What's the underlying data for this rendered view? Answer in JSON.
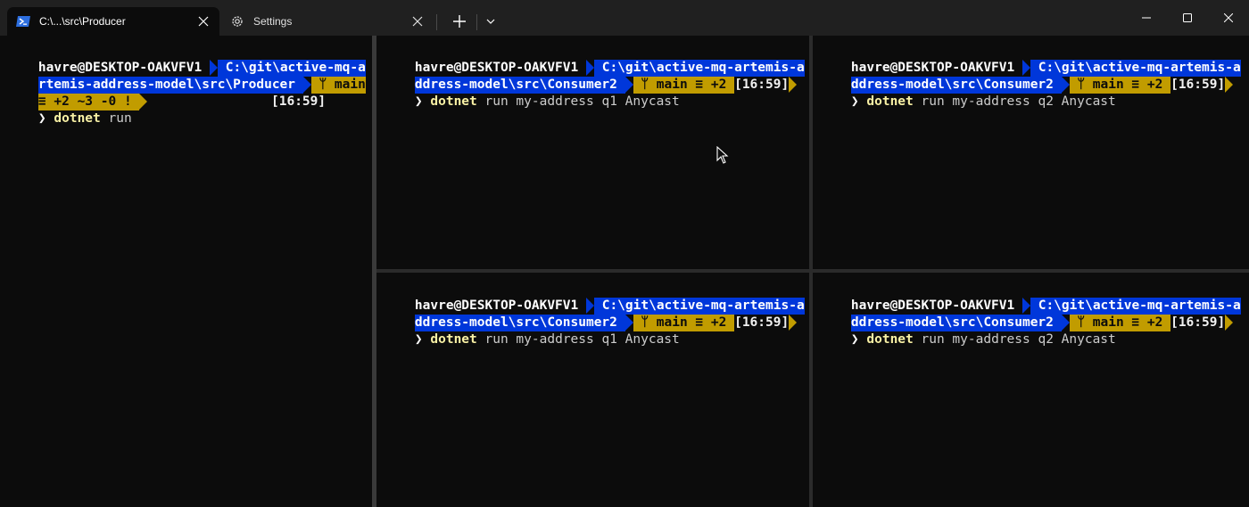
{
  "window": {
    "tabs": [
      {
        "label": "C:\\...\\src\\Producer",
        "icon": "powershell-icon",
        "active": true
      },
      {
        "label": "Settings",
        "icon": "gear-icon",
        "active": false
      }
    ]
  },
  "colors": {
    "path_bg": "#0037da",
    "git_bg": "#c19c00",
    "terminal_bg": "#0c0c0c",
    "command": "#f9f1a5"
  },
  "panes": [
    {
      "name": "producer",
      "lines": [
        {
          "user": "havre@DESKTOP-OAKVFV1 ",
          "path": " C:\\git\\active-mq-a"
        },
        {
          "path": "rtemis-address-model\\src\\Producer ",
          "git": " ᛘ main"
        },
        {
          "git": "≡ +2 ~3 -0 ! ",
          "time": "[16:59]"
        }
      ],
      "prompt": {
        "symbol": "❯",
        "command": "dotnet",
        "args": "run"
      }
    },
    {
      "name": "consumer-top-left",
      "lines": [
        {
          "user": "havre@DESKTOP-OAKVFV1 ",
          "path": " C:\\git\\active-mq-artemis-a"
        },
        {
          "path": "ddress-model\\src\\Consumer2 ",
          "git": " ᛘ main ≡ +2 ",
          "time": "[16:59]"
        }
      ],
      "prompt": {
        "symbol": "❯",
        "command": "dotnet",
        "args": "run my-address q1 Anycast"
      }
    },
    {
      "name": "consumer-top-right",
      "lines": [
        {
          "user": "havre@DESKTOP-OAKVFV1 ",
          "path": " C:\\git\\active-mq-artemis-a"
        },
        {
          "path": "ddress-model\\src\\Consumer2 ",
          "git": " ᛘ main ≡ +2 ",
          "time": "[16:59]"
        }
      ],
      "prompt": {
        "symbol": "❯",
        "command": "dotnet",
        "args": "run my-address q2 Anycast"
      }
    },
    {
      "name": "consumer-bottom-left",
      "lines": [
        {
          "user": "havre@DESKTOP-OAKVFV1 ",
          "path": " C:\\git\\active-mq-artemis-a"
        },
        {
          "path": "ddress-model\\src\\Consumer2 ",
          "git": " ᛘ main ≡ +2 ",
          "time": "[16:59]"
        }
      ],
      "prompt": {
        "symbol": "❯",
        "command": "dotnet",
        "args": "run my-address q1 Anycast"
      }
    },
    {
      "name": "consumer-bottom-right",
      "lines": [
        {
          "user": "havre@DESKTOP-OAKVFV1 ",
          "path": " C:\\git\\active-mq-artemis-a"
        },
        {
          "path": "ddress-model\\src\\Consumer2 ",
          "git": " ᛘ main ≡ +2 ",
          "time": "[16:59]"
        }
      ],
      "prompt": {
        "symbol": "❯",
        "command": "dotnet",
        "args": "run my-address q2 Anycast"
      }
    }
  ]
}
